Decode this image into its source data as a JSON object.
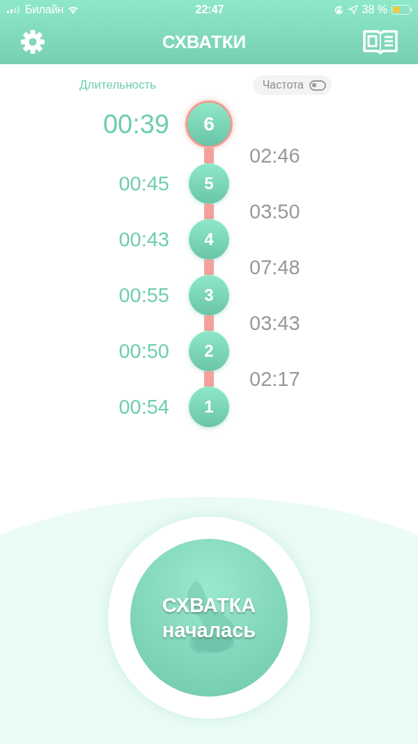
{
  "status_bar": {
    "carrier": "Билайн",
    "time": "22:47",
    "battery": "38 %"
  },
  "nav_bar": {
    "title": "СХВАТКИ"
  },
  "header": {
    "duration_label": "Длительность",
    "frequency_toggle": {
      "label": "Частота",
      "on": false
    }
  },
  "contractions": [
    {
      "number": "6",
      "duration": "00:39",
      "interval": "02:46",
      "selected": true
    },
    {
      "number": "5",
      "duration": "00:45",
      "interval": "03:50",
      "selected": false
    },
    {
      "number": "4",
      "duration": "00:43",
      "interval": "07:48",
      "selected": false
    },
    {
      "number": "3",
      "duration": "00:55",
      "interval": "03:43",
      "selected": false
    },
    {
      "number": "2",
      "duration": "00:50",
      "interval": "02:17",
      "selected": false
    },
    {
      "number": "1",
      "duration": "00:54",
      "selected": false
    }
  ],
  "start_button": {
    "line_1": "СХВАТКА",
    "line_2": "началась"
  }
}
